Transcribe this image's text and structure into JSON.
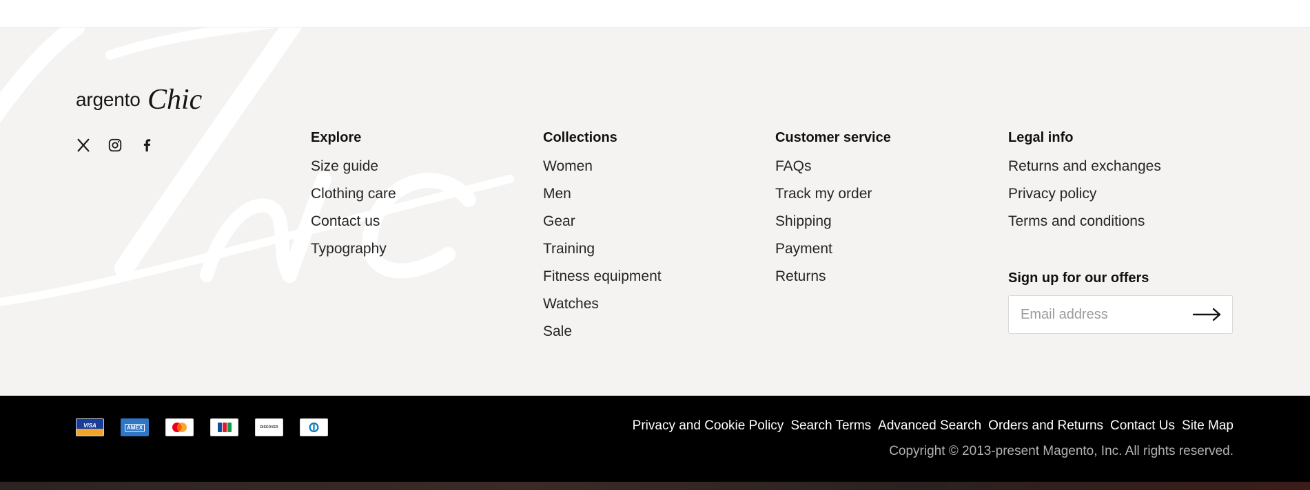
{
  "brand": {
    "wordmark": "argento",
    "script": "Chic"
  },
  "social": [
    {
      "icon": "x-icon"
    },
    {
      "icon": "instagram-icon"
    },
    {
      "icon": "facebook-icon"
    }
  ],
  "columns": {
    "explore": {
      "title": "Explore",
      "links": [
        "Size guide",
        "Clothing care",
        "Contact us",
        "Typography"
      ]
    },
    "collections": {
      "title": "Collections",
      "links": [
        "Women",
        "Men",
        "Gear",
        "Training",
        "Fitness equipment",
        "Watches",
        "Sale"
      ]
    },
    "customer_service": {
      "title": "Customer service",
      "links": [
        "FAQs",
        "Track my order",
        "Shipping",
        "Payment",
        "Returns"
      ]
    },
    "legal": {
      "title": "Legal info",
      "links": [
        "Returns and exchanges",
        "Privacy policy",
        "Terms and conditions"
      ]
    }
  },
  "newsletter": {
    "title": "Sign up for our offers",
    "placeholder": "Email address",
    "value": ""
  },
  "payments": [
    {
      "icon": "visa-icon",
      "label": "VISA"
    },
    {
      "icon": "amex-icon",
      "label": "AMEX"
    },
    {
      "icon": "mastercard-icon",
      "label": ""
    },
    {
      "icon": "jcb-icon",
      "label": "JCB"
    },
    {
      "icon": "discover-icon",
      "label": "DISCOVER"
    },
    {
      "icon": "diners-club-icon",
      "label": ""
    }
  ],
  "bottom_links": [
    "Privacy and Cookie Policy",
    "Search Terms",
    "Advanced Search",
    "Orders and Returns",
    "Contact Us",
    "Site Map"
  ],
  "copyright": "Copyright © 2013-present Magento, Inc. All rights reserved.",
  "colors": {
    "footer_bg": "#f4f3f1",
    "bottom_bar_bg": "#000000",
    "heading": "#101010",
    "link": "#252525",
    "copyright": "#b3b3b3"
  }
}
